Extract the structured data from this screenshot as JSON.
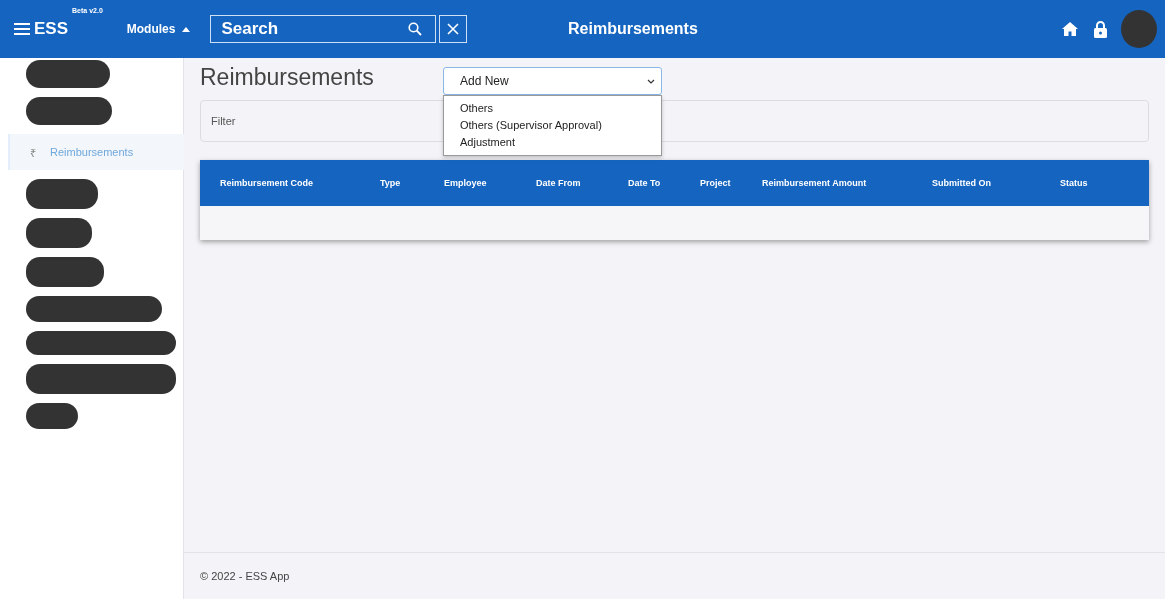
{
  "header": {
    "brand": "ESS",
    "badge": "Beta v2.0",
    "modules_menu": {
      "label": "Modules",
      "expanded": true
    },
    "search": {
      "placeholder": "Search"
    },
    "title": "Reimbursements"
  },
  "sidebar": {
    "items": [
      {
        "icon": "₹",
        "label": "Reimbursements",
        "selected": true
      }
    ]
  },
  "page": {
    "heading": "Reimbursements",
    "add_new": {
      "value": "Add New",
      "expanded": true,
      "options": [
        "Others",
        "Others (Supervisor Approval)",
        "Adjustment"
      ]
    },
    "filter": {
      "placeholder": "Filter"
    }
  },
  "table": {
    "columns": [
      "Reimbursement Code",
      "Type",
      "Employee",
      "Date From",
      "Date To",
      "Project",
      "Reimbursement Amount",
      "Submitted On",
      "Status"
    ]
  },
  "footer": {
    "text": "© 2022 - ESS App"
  }
}
